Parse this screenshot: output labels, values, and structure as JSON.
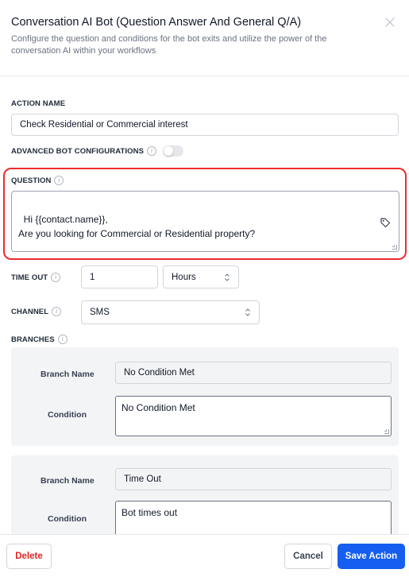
{
  "header": {
    "title": "Conversation AI Bot (Question Answer And General Q/A)",
    "subtitle": "Configure the question and conditions for the bot exits and utilize the power of the conversation AI within your workflows"
  },
  "action_name": {
    "label": "ACTION NAME",
    "value": "Check Residential or Commercial interest"
  },
  "advanced": {
    "label": "ADVANCED BOT CONFIGURATIONS",
    "enabled": false
  },
  "question": {
    "label": "QUESTION",
    "value": "Hi {{contact.name}},\nAre you looking for Commercial or Residential property?"
  },
  "timeout": {
    "label": "TIME OUT",
    "value": "1",
    "unit": "Hours"
  },
  "channel": {
    "label": "CHANNEL",
    "value": "SMS"
  },
  "branches": {
    "label": "BRANCHES",
    "items": [
      {
        "name_label": "Branch Name",
        "name": "No Condition Met",
        "condition_label": "Condition",
        "condition": "No Condition Met"
      },
      {
        "name_label": "Branch Name",
        "name": "Time Out",
        "condition_label": "Condition",
        "condition": "Bot times out"
      }
    ]
  },
  "footer": {
    "delete_label": "Delete",
    "cancel_label": "Cancel",
    "save_label": "Save Action"
  },
  "colors": {
    "accent": "#155eef",
    "danger": "#dc2626",
    "highlight": "#ef2a2a"
  }
}
